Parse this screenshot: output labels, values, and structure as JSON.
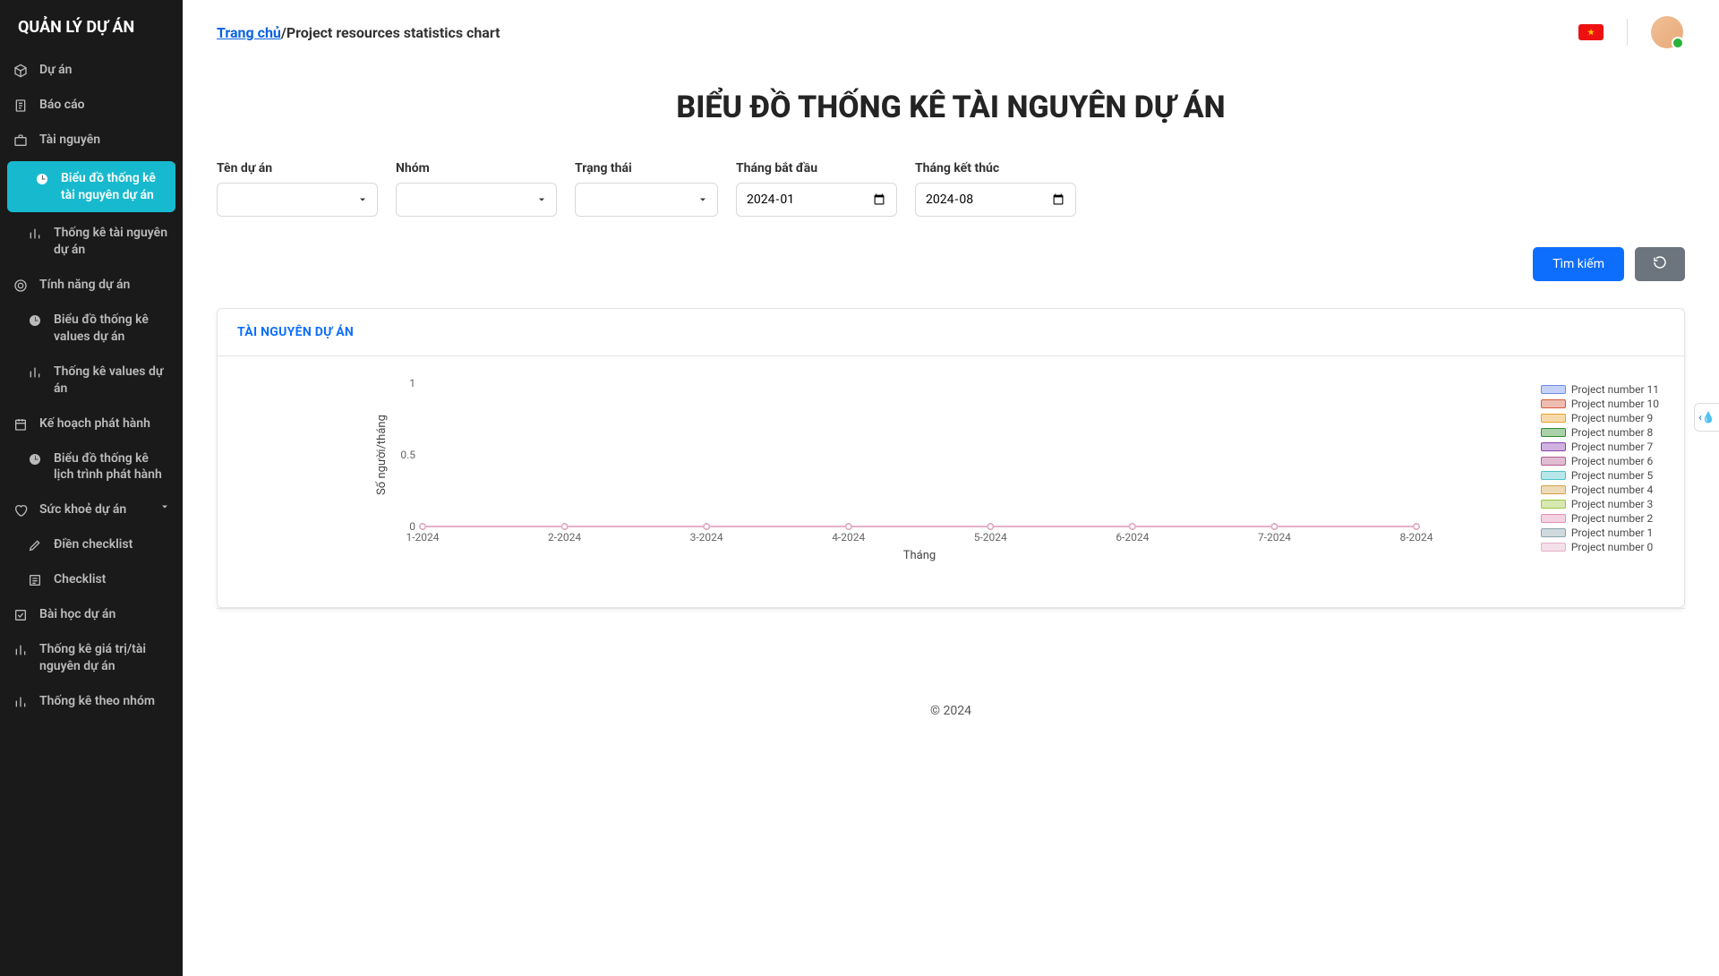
{
  "brand": "QUẢN LÝ DỰ ÁN",
  "sidebar": {
    "items": [
      {
        "label": "Dự án",
        "icon": "box"
      },
      {
        "label": "Báo cáo",
        "icon": "doc"
      },
      {
        "label": "Tài nguyên",
        "icon": "briefcase"
      },
      {
        "label": "Biểu đồ thống kê tài nguyên dự án",
        "icon": "clock",
        "active": true,
        "sub": true
      },
      {
        "label": "Thống kê tài nguyên dự án",
        "icon": "bar",
        "sub": true
      },
      {
        "label": "Tính năng dự án",
        "icon": "target"
      },
      {
        "label": "Biểu đồ thống kê values dự án",
        "icon": "clock",
        "sub": true
      },
      {
        "label": "Thống kê values dự án",
        "icon": "bar",
        "sub": true
      },
      {
        "label": "Kế hoạch phát hành",
        "icon": "calendar"
      },
      {
        "label": "Biểu đồ thống kê lịch trình phát hành",
        "icon": "clock",
        "sub": true
      },
      {
        "label": "Sức khoẻ dự án",
        "icon": "heart",
        "chev": true
      },
      {
        "label": "Điền checklist",
        "icon": "pencil",
        "sub": true
      },
      {
        "label": "Checklist",
        "icon": "list",
        "sub": true
      },
      {
        "label": "Bài học dự án",
        "icon": "check"
      },
      {
        "label": "Thống kê giá trị/tài nguyên dự án",
        "icon": "bar"
      },
      {
        "label": "Thống kê theo nhóm",
        "icon": "bar"
      }
    ]
  },
  "breadcrumb": {
    "home": "Trang chủ",
    "sep": "/",
    "current": "Project resources statistics chart"
  },
  "page_title": "BIỂU ĐỒ THỐNG KÊ TÀI NGUYÊN DỰ ÁN",
  "filters": {
    "project_label": "Tên dự án",
    "group_label": "Nhóm",
    "status_label": "Trạng thái",
    "start_label": "Tháng bắt đầu",
    "end_label": "Tháng kết thúc",
    "start_value": "2024-01",
    "start_display": "January 2024",
    "end_value": "2024-08",
    "end_display": "August 2024"
  },
  "actions": {
    "search": "Tìm kiếm"
  },
  "chart_header": "TÀI NGUYÊN DỰ ÁN",
  "chart_data": {
    "type": "line",
    "xlabel": "Tháng",
    "ylabel": "Số người/tháng",
    "ylim": [
      0,
      1
    ],
    "yticks": [
      0,
      0.5,
      1
    ],
    "categories": [
      "1-2024",
      "2-2024",
      "3-2024",
      "4-2024",
      "5-2024",
      "6-2024",
      "7-2024",
      "8-2024"
    ],
    "series": [
      {
        "name": "Project number 11",
        "color": "#6e8de8",
        "values": [
          0,
          0,
          0,
          0,
          0,
          0,
          0,
          0
        ]
      },
      {
        "name": "Project number 10",
        "color": "#d35b3c",
        "values": [
          0,
          0,
          0,
          0,
          0,
          0,
          0,
          0
        ]
      },
      {
        "name": "Project number 9",
        "color": "#e8a22e",
        "values": [
          0,
          0,
          0,
          0,
          0,
          0,
          0,
          0
        ]
      },
      {
        "name": "Project number 8",
        "color": "#2e8b2e",
        "values": [
          0,
          0,
          0,
          0,
          0,
          0,
          0,
          0
        ]
      },
      {
        "name": "Project number 7",
        "color": "#8a3fb0",
        "values": [
          0,
          0,
          0,
          0,
          0,
          0,
          0,
          0
        ]
      },
      {
        "name": "Project number 6",
        "color": "#b55b8f",
        "values": [
          0,
          0,
          0,
          0,
          0,
          0,
          0,
          0
        ]
      },
      {
        "name": "Project number 5",
        "color": "#4cc3c9",
        "values": [
          0,
          0,
          0,
          0,
          0,
          0,
          0,
          0
        ]
      },
      {
        "name": "Project number 4",
        "color": "#d5a24a",
        "values": [
          0,
          0,
          0,
          0,
          0,
          0,
          0,
          0
        ]
      },
      {
        "name": "Project number 3",
        "color": "#9bc53d",
        "values": [
          0,
          0,
          0,
          0,
          0,
          0,
          0,
          0
        ]
      },
      {
        "name": "Project number 2",
        "color": "#e28fb4",
        "values": [
          0,
          0,
          0,
          0,
          0,
          0,
          0,
          0
        ]
      },
      {
        "name": "Project number 1",
        "color": "#8aa2ad",
        "values": [
          0,
          0,
          0,
          0,
          0,
          0,
          0,
          0
        ]
      },
      {
        "name": "Project number 0",
        "color": "#e6b0c9",
        "values": [
          0,
          0,
          0,
          0,
          0,
          0,
          0,
          0
        ]
      }
    ]
  },
  "footer": "© 2024"
}
